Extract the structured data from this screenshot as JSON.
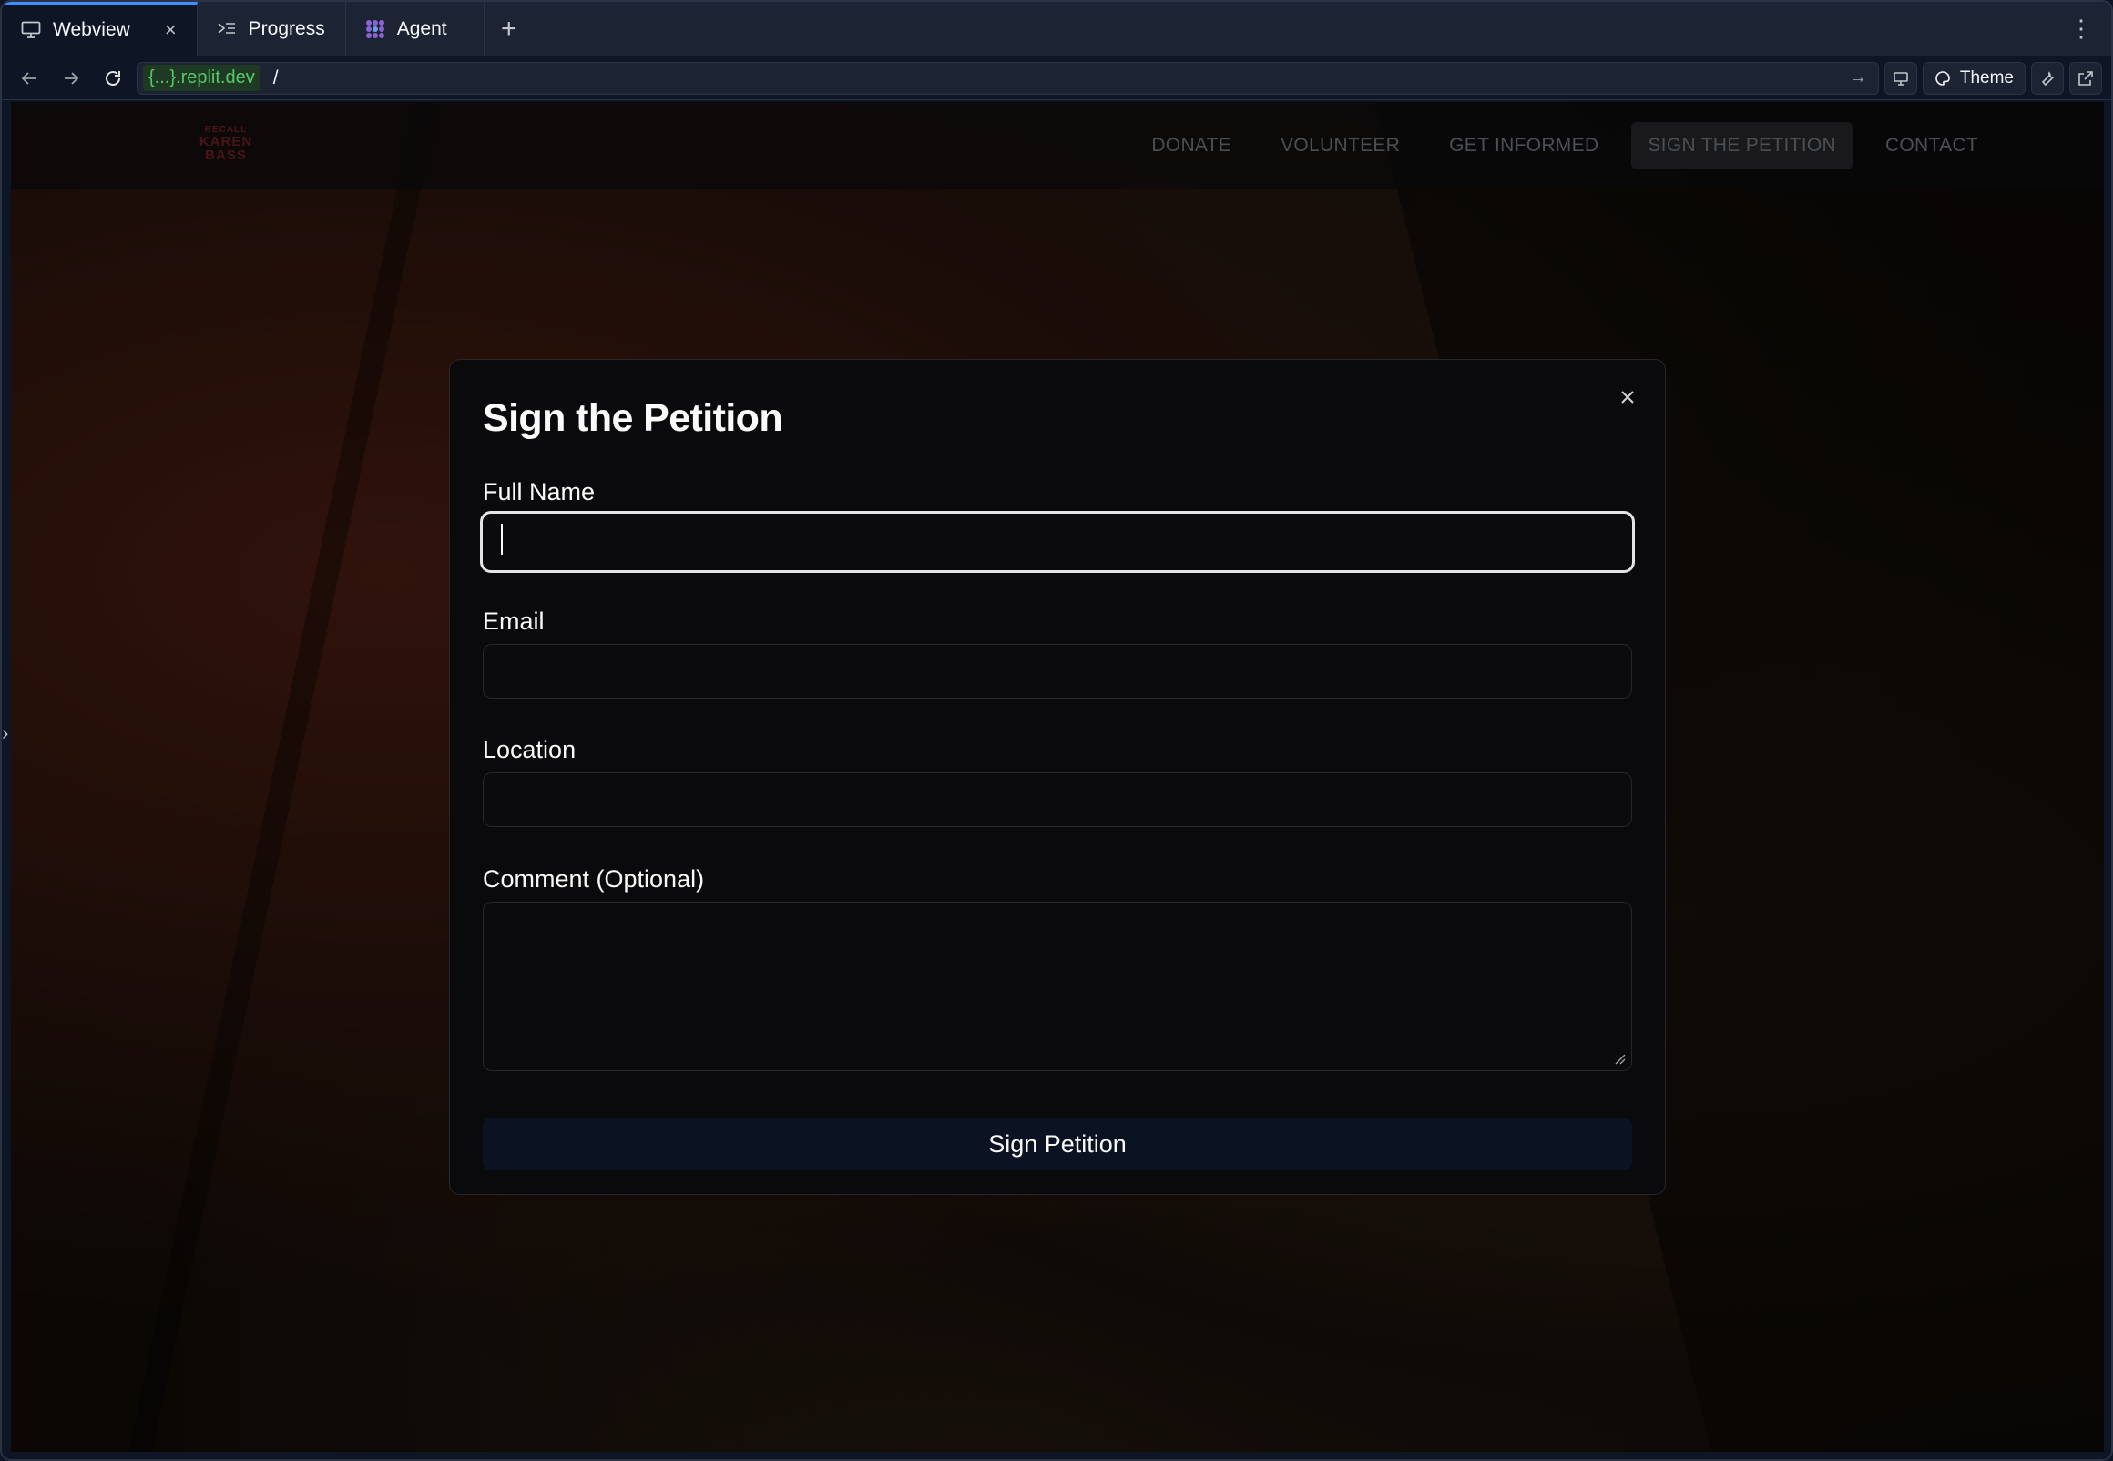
{
  "tabs": [
    {
      "label": "Webview",
      "icon": "monitor-icon",
      "active": true
    },
    {
      "label": "Progress",
      "icon": "progress-icon",
      "active": false
    },
    {
      "label": "Agent",
      "icon": "agent-icon",
      "active": false
    }
  ],
  "url": {
    "host": "{...}.replit.dev",
    "path": "/"
  },
  "toolbar": {
    "theme_label": "Theme"
  },
  "site": {
    "logo": {
      "line1": "RECALL",
      "line2": "KAREN",
      "line3": "BASS"
    },
    "nav": [
      "DONATE",
      "VOLUNTEER",
      "GET INFORMED",
      "SIGN THE PETITION",
      "CONTACT"
    ],
    "active_nav": "SIGN THE PETITION"
  },
  "modal": {
    "title": "Sign the Petition",
    "fields": {
      "full_name": {
        "label": "Full Name",
        "value": ""
      },
      "email": {
        "label": "Email",
        "value": ""
      },
      "location": {
        "label": "Location",
        "value": ""
      },
      "comment": {
        "label": "Comment (Optional)",
        "value": ""
      }
    },
    "submit_label": "Sign Petition"
  },
  "colors": {
    "accent_tab": "#3b8fff",
    "host_badge": "#58c76b",
    "modal_bg": "#0a0a0c",
    "submit_bg": "#0b1222"
  }
}
